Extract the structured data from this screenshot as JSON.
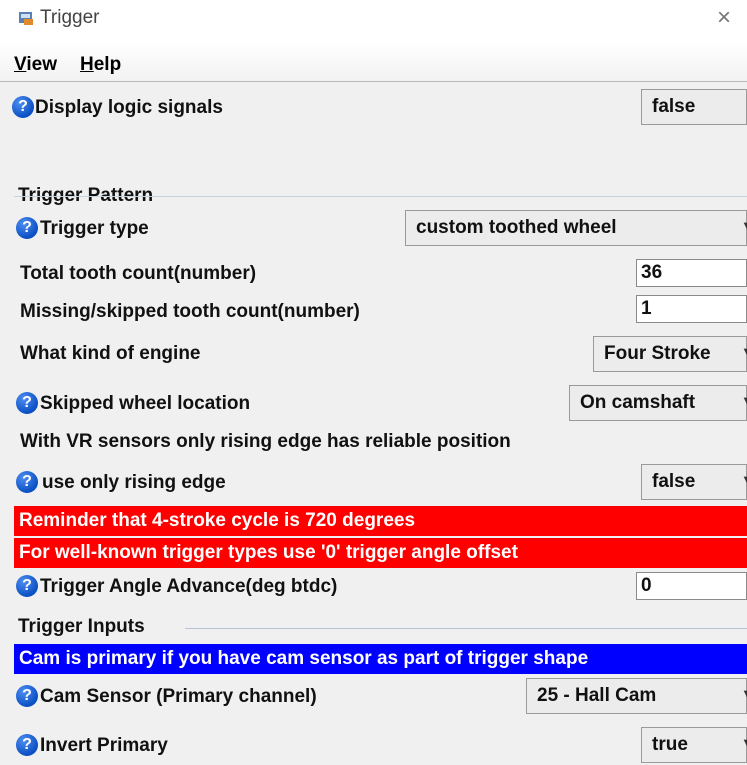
{
  "window": {
    "title": "Trigger",
    "close_glyph": "×"
  },
  "menu": [
    {
      "mnemonic": "V",
      "rest": "iew"
    },
    {
      "mnemonic": "H",
      "rest": "elp"
    }
  ],
  "display_logic": {
    "label": "Display logic signals",
    "value": "false"
  },
  "sections": {
    "trigger_pattern": "Trigger Pattern",
    "trigger_inputs": "Trigger Inputs"
  },
  "fields": {
    "trigger_type": {
      "label": "Trigger type",
      "value": "custom toothed wheel"
    },
    "total_tooth": {
      "label": "Total tooth count(number)",
      "value": "36"
    },
    "missing_tooth": {
      "label": "Missing/skipped tooth count(number)",
      "value": "1"
    },
    "engine_kind": {
      "label": "What kind of engine",
      "value": "Four Stroke"
    },
    "skipped_location": {
      "label": "Skipped wheel location",
      "value": "On camshaft"
    },
    "vr_note": "With VR sensors only rising edge has reliable position",
    "rising_edge": {
      "label": "use only rising edge",
      "value": "false"
    },
    "angle_advance": {
      "label": "Trigger Angle Advance(deg btdc)",
      "value": "0"
    },
    "cam_sensor": {
      "label": "Cam Sensor (Primary channel)",
      "value": "25 - Hall Cam"
    },
    "invert_primary": {
      "label": "Invert Primary",
      "value": "true"
    }
  },
  "banners": {
    "reminder": "Reminder that 4-stroke cycle is 720 degrees",
    "well_known": "For well-known trigger types use '0' trigger angle offset",
    "cam_primary": "Cam is primary if you have cam sensor as part of trigger shape"
  },
  "colors": {
    "red_banner": "#ff0000",
    "blue_banner": "#0000ff",
    "help_icon": "#0b4fc4"
  },
  "icons": {
    "help": "help-question-icon",
    "window": "app-window-icon",
    "dropdown": "chevron-down-icon"
  }
}
